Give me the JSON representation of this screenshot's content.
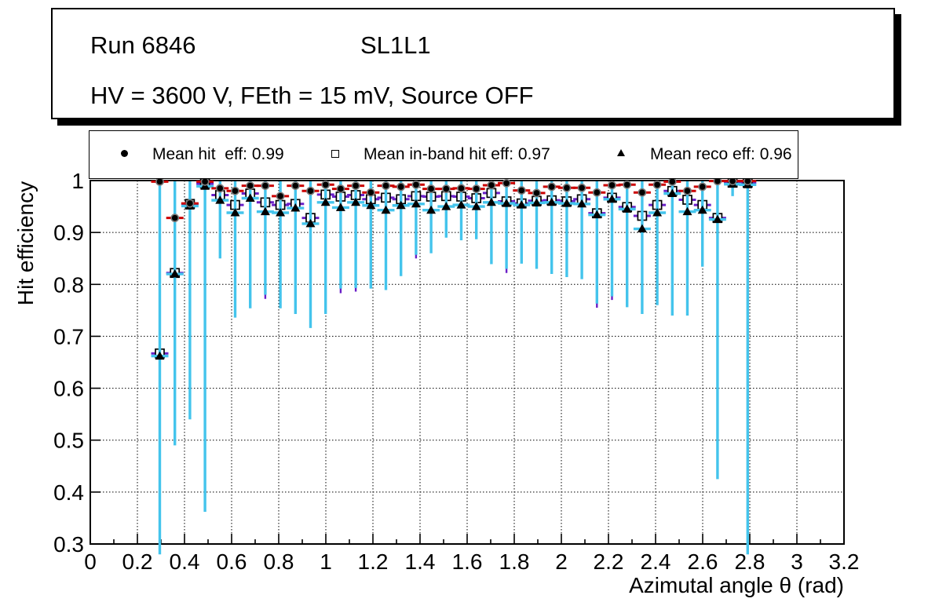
{
  "title_box": {
    "run": "Run 6846",
    "chamber": "SL1L1",
    "conditions": "HV = 3600 V, FEth = 15 mV, Source OFF"
  },
  "legend": {
    "entries": [
      {
        "marker": "filled-circle",
        "label": "Mean hit  eff: 0.99"
      },
      {
        "marker": "open-square",
        "label": "Mean in-band hit eff: 0.97"
      },
      {
        "marker": "filled-triangle",
        "label": "Mean reco eff: 0.96"
      }
    ]
  },
  "colors": {
    "hit_errbar": "#cc0000",
    "inband_errbar": "#6a1fc7",
    "reco_errbar": "#44c4ec",
    "marker": "#000000",
    "frame": "#000000",
    "background": "#ffffff"
  },
  "chart_data": {
    "type": "scatter",
    "title": "",
    "xlabel": "Azimutal angle θ (rad)",
    "ylabel": "Hit efficiency",
    "xlim": [
      0,
      3.2
    ],
    "ylim": [
      0.3,
      1.0
    ],
    "x_tick_labels": [
      "0",
      "0.2",
      "0.4",
      "0.6",
      "0.8",
      "1",
      "1.2",
      "1.4",
      "1.6",
      "1.8",
      "2",
      "2.2",
      "2.4",
      "2.6",
      "2.8",
      "3",
      "3.2"
    ],
    "y_tick_labels": [
      "0.3",
      "0.4",
      "0.5",
      "0.6",
      "0.7",
      "0.8",
      "0.9",
      "1"
    ],
    "grid": "dotted",
    "legend_position": "top",
    "series": [
      {
        "name": "Mean hit eff",
        "mean": 0.99,
        "marker": "filled-circle",
        "errbar_color": "#cc0000"
      },
      {
        "name": "Mean in-band hit eff",
        "mean": 0.97,
        "marker": "open-square",
        "errbar_color": "#6a1fc7"
      },
      {
        "name": "Mean reco eff",
        "mean": 0.96,
        "marker": "filled-triangle",
        "errbar_color": "#44c4ec"
      }
    ],
    "points_format": [
      "x_rad",
      "hit_eff",
      "inband_eff",
      "reco_eff",
      "err_low",
      "purple_err_low"
    ],
    "points": [
      [
        0.295,
        0.998,
        0.667,
        0.662,
        0.28,
        null
      ],
      [
        0.359,
        0.928,
        0.822,
        0.82,
        0.49,
        null
      ],
      [
        0.423,
        0.956,
        0.955,
        0.951,
        0.54,
        null
      ],
      [
        0.487,
        0.998,
        0.994,
        0.989,
        0.362,
        null
      ],
      [
        0.551,
        0.985,
        0.972,
        0.962,
        0.85,
        null
      ],
      [
        0.615,
        0.98,
        0.953,
        0.938,
        0.736,
        null
      ],
      [
        0.679,
        0.99,
        0.975,
        0.966,
        0.754,
        null
      ],
      [
        0.743,
        0.99,
        0.958,
        0.94,
        0.78,
        0.772
      ],
      [
        0.807,
        0.97,
        0.953,
        0.938,
        0.754,
        null
      ],
      [
        0.871,
        0.99,
        0.955,
        0.947,
        0.743,
        null
      ],
      [
        0.935,
        0.98,
        0.928,
        0.917,
        0.716,
        null
      ],
      [
        0.999,
        0.992,
        0.973,
        0.958,
        0.743,
        null
      ],
      [
        1.063,
        0.984,
        0.969,
        0.948,
        0.792,
        0.783
      ],
      [
        1.127,
        0.99,
        0.972,
        0.958,
        0.793,
        0.786
      ],
      [
        1.191,
        0.977,
        0.964,
        0.952,
        0.792,
        null
      ],
      [
        1.255,
        0.99,
        0.967,
        0.943,
        0.789,
        null
      ],
      [
        1.319,
        0.988,
        0.964,
        0.952,
        0.816,
        null
      ],
      [
        1.383,
        0.992,
        0.97,
        0.955,
        0.857,
        0.85
      ],
      [
        1.447,
        0.984,
        0.969,
        0.943,
        0.86,
        null
      ],
      [
        1.511,
        0.984,
        0.97,
        0.95,
        0.89,
        null
      ],
      [
        1.575,
        0.985,
        0.969,
        0.953,
        0.885,
        null
      ],
      [
        1.639,
        0.984,
        0.966,
        0.95,
        0.887,
        null
      ],
      [
        1.703,
        0.991,
        0.976,
        0.958,
        0.839,
        null
      ],
      [
        1.767,
        0.995,
        0.96,
        0.956,
        0.83,
        0.822
      ],
      [
        1.831,
        0.981,
        0.956,
        0.953,
        0.84,
        null
      ],
      [
        1.895,
        0.976,
        0.961,
        0.957,
        0.83,
        null
      ],
      [
        1.959,
        0.988,
        0.962,
        0.958,
        0.82,
        null
      ],
      [
        2.023,
        0.986,
        0.96,
        0.956,
        0.814,
        null
      ],
      [
        2.087,
        0.986,
        0.964,
        0.955,
        0.81,
        null
      ],
      [
        2.151,
        0.977,
        0.937,
        0.934,
        0.763,
        0.755
      ],
      [
        2.215,
        0.991,
        0.967,
        0.964,
        0.777,
        0.77
      ],
      [
        2.279,
        0.992,
        0.949,
        0.945,
        0.756,
        null
      ],
      [
        2.343,
        0.977,
        0.932,
        0.907,
        0.743,
        null
      ],
      [
        2.407,
        0.992,
        0.953,
        0.938,
        0.76,
        null
      ],
      [
        2.471,
        0.998,
        0.98,
        0.975,
        0.74,
        null
      ],
      [
        2.535,
        0.98,
        0.963,
        0.94,
        0.74,
        null
      ],
      [
        2.599,
        0.988,
        0.953,
        0.943,
        0.834,
        null
      ],
      [
        2.663,
        0.999,
        0.928,
        0.925,
        0.425,
        null
      ],
      [
        2.727,
        0.999,
        0.996,
        0.993,
        0.97,
        null
      ],
      [
        2.791,
        0.999,
        0.996,
        0.992,
        0.28,
        null
      ]
    ]
  }
}
